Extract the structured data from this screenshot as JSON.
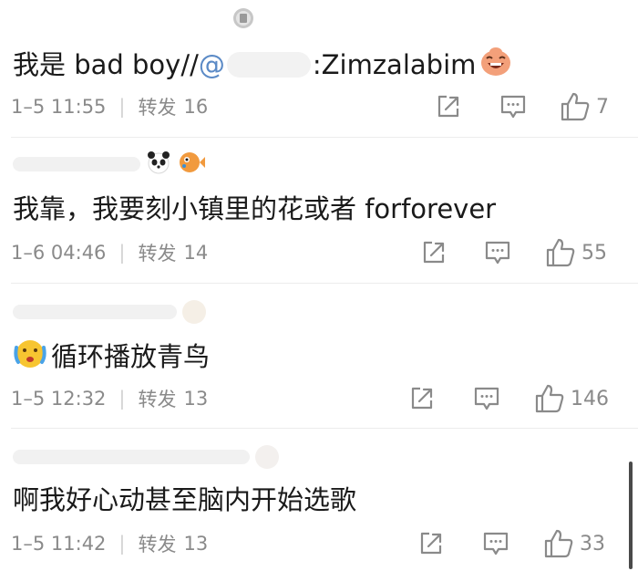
{
  "comments": [
    {
      "text_prefix": "我是 bad boy//",
      "mention_char": "@",
      "text_suffix": ":Zimzalabim",
      "date": "1–5 11:55",
      "separator": "|",
      "repost_label": "转发",
      "repost_count": "16",
      "like_count": "7"
    },
    {
      "text": "我靠，我要刻小镇里的花或者 forforever",
      "date": "1–6 04:46",
      "separator": "|",
      "repost_label": "转发",
      "repost_count": "14",
      "like_count": "55"
    },
    {
      "text": "循环播放青鸟",
      "date": "1–5 12:32",
      "separator": "|",
      "repost_label": "转发",
      "repost_count": "13",
      "like_count": "146"
    },
    {
      "text": "啊我好心动甚至脑内开始选歌",
      "date": "1–5 11:42",
      "separator": "|",
      "repost_label": "转发",
      "repost_count": "13",
      "like_count": "33"
    }
  ],
  "icons": {
    "share": "share-out-icon",
    "comment": "comment-icon",
    "like": "thumbs-up-icon",
    "emoji_laugh": "laughing-face-emoji-icon",
    "emoji_cry": "crying-face-emoji-icon",
    "emoji_panda": "panda-emoji-icon",
    "emoji_pufferfish": "pufferfish-emoji-icon",
    "badge": "medal-badge-icon"
  },
  "colors": {
    "text": "#1a1a1a",
    "meta": "#8a8a8a",
    "divider": "#ececec",
    "mention": "#5b8ac6"
  }
}
